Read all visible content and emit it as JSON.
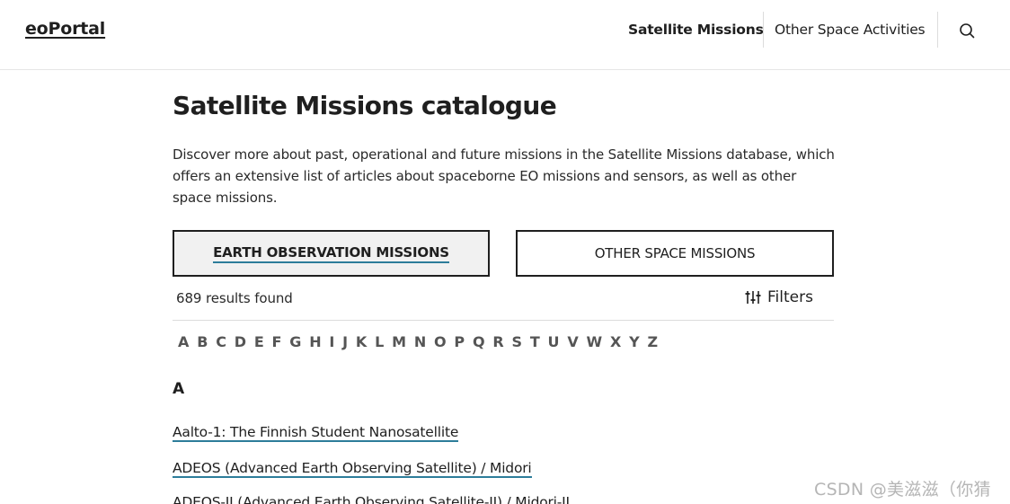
{
  "header": {
    "logo": "eoPortal",
    "nav": [
      {
        "label": "Satellite Missions"
      },
      {
        "label": "Other Space Activities"
      }
    ],
    "search_icon": "search-icon"
  },
  "main": {
    "title": "Satellite Missions catalogue",
    "intro": "Discover more about past, operational and future missions in the Satellite Missions database, which offers an extensive list of articles about spaceborne EO missions and sensors, as well as other space missions.",
    "tabs": [
      {
        "label": "EARTH OBSERVATION MISSIONS",
        "active": true
      },
      {
        "label": "OTHER SPACE MISSIONS",
        "active": false
      }
    ],
    "results_count": "689 results found",
    "filters_label": "Filters",
    "filters_icon": "sliders-icon",
    "alphabet": [
      "A",
      "B",
      "C",
      "D",
      "E",
      "F",
      "G",
      "H",
      "I",
      "J",
      "K",
      "L",
      "M",
      "N",
      "O",
      "P",
      "Q",
      "R",
      "S",
      "T",
      "U",
      "V",
      "W",
      "X",
      "Y",
      "Z"
    ],
    "section_letter": "A",
    "missions": [
      "Aalto-1: The Finnish Student Nanosatellite",
      "ADEOS (Advanced Earth Observing Satellite) / Midori",
      "ADEOS-II (Advanced Earth Observing Satellite-II) / Midori-II"
    ]
  },
  "watermark": "CSDN @美滋滋（你猜",
  "colors": {
    "accent_underline": "#2d7d9a",
    "text": "#1f1f1f",
    "active_tab_bg": "#f1f1f1"
  }
}
